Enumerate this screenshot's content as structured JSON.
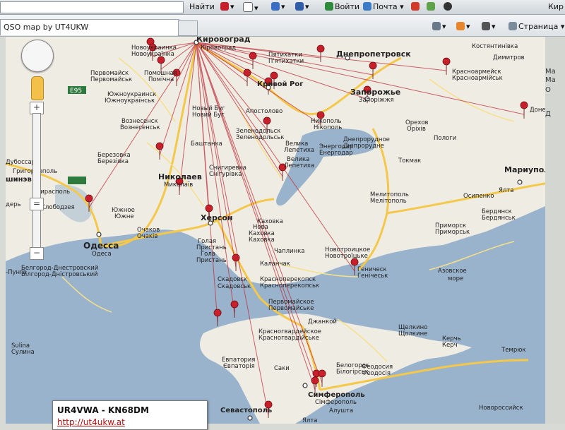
{
  "toolbar": {
    "find_label": "Найти",
    "login_label": "Войти",
    "mail_label": "Почта",
    "right_text": "Кир"
  },
  "tab": {
    "title": "QSO map by UT4UKW"
  },
  "commands": {
    "page_label": "Страница"
  },
  "map": {
    "labels": [
      {
        "id": "kirovograd",
        "text": "Кировоград",
        "bold": true
      },
      {
        "id": "kirovograd2",
        "text": "Кіровоград"
      },
      {
        "id": "novoukrainka",
        "text": "Новоукраинка"
      },
      {
        "id": "novoukrainka2",
        "text": "Новоукраїнка"
      },
      {
        "id": "pervomaysk",
        "text": "Первомайск"
      },
      {
        "id": "pervomaysk2",
        "text": "Первомайськ"
      },
      {
        "id": "pomoshnaya",
        "text": "Помошная"
      },
      {
        "id": "pomichna",
        "text": "Помічна"
      },
      {
        "id": "yuzhnoukrainsk",
        "text": "Южноукраинск"
      },
      {
        "id": "yuzhnoukrainsk2",
        "text": "Южноукраїнськ"
      },
      {
        "id": "voznesensk",
        "text": "Вознесенск"
      },
      {
        "id": "voznesensk2",
        "text": "Вознесенськ"
      },
      {
        "id": "novybug",
        "text": "Новый Буг"
      },
      {
        "id": "novybug2",
        "text": "Новий Буг"
      },
      {
        "id": "pyatikhatki",
        "text": "Пятихатки"
      },
      {
        "id": "piatykhatky",
        "text": "П'ятихатки"
      },
      {
        "id": "krivoy",
        "text": "Кривой Рог",
        "bold": true
      },
      {
        "id": "dnepro",
        "text": "Днепропетровск",
        "bold": true
      },
      {
        "id": "zaporozhye",
        "text": "Запорожье",
        "bold": true
      },
      {
        "id": "zaporizhia",
        "text": "Запоріжжя"
      },
      {
        "id": "apostolovo",
        "text": "Апостолово"
      },
      {
        "id": "nikopol",
        "text": "Никополь"
      },
      {
        "id": "nikopol2",
        "text": "Нікополь"
      },
      {
        "id": "zelenodolsk",
        "text": "Зеленодольск"
      },
      {
        "id": "zelenodolsk2",
        "text": "Зеленодольськ"
      },
      {
        "id": "krasnoarmeysk",
        "text": "Красноармейск"
      },
      {
        "id": "krasnoarmiysk",
        "text": "Красноармійськ"
      },
      {
        "id": "kostiantynivka",
        "text": "Костянтинівка"
      },
      {
        "id": "dimitrov",
        "text": "Димитров"
      },
      {
        "id": "donets",
        "text": "Донец"
      },
      {
        "id": "berezovka",
        "text": "Березовка"
      },
      {
        "id": "berezivka",
        "text": "Березівка"
      },
      {
        "id": "dubossary",
        "text": "Дубоссары"
      },
      {
        "id": "grigoriopol",
        "text": "Григориополь"
      },
      {
        "id": "chisinau",
        "text": "шинэв"
      },
      {
        "id": "tiraspol",
        "text": "Тирасполь"
      },
      {
        "id": "slobodzeya",
        "text": "Слободзея"
      },
      {
        "id": "bendery",
        "text": "дерь"
      },
      {
        "id": "bashtanka",
        "text": "Баштанка"
      },
      {
        "id": "snigirevka",
        "text": "Снигиревка"
      },
      {
        "id": "snihurivka",
        "text": "Снігурівка"
      },
      {
        "id": "nikolaev",
        "text": "Николаев",
        "bold": true
      },
      {
        "id": "mykolaiv",
        "text": "Миколаїв"
      },
      {
        "id": "yuzhnoe",
        "text": "Южное"
      },
      {
        "id": "yuzhne",
        "text": "Южне"
      },
      {
        "id": "ochakov",
        "text": "Очаков"
      },
      {
        "id": "ochakiv",
        "text": "Очаків"
      },
      {
        "id": "odessa",
        "text": "Одесса",
        "bold": true
      },
      {
        "id": "odesa",
        "text": "Одеса"
      },
      {
        "id": "kherson",
        "text": "Херсон",
        "bold": true
      },
      {
        "id": "golaya",
        "text": "Голая"
      },
      {
        "id": "pristan",
        "text": "Пристань"
      },
      {
        "id": "hola",
        "text": "Гола"
      },
      {
        "id": "prystan",
        "text": "Пристань"
      },
      {
        "id": "kakhovka",
        "text": "Каховка"
      },
      {
        "id": "nova",
        "text": "Нова"
      },
      {
        "id": "kakhovka2",
        "text": "Каховка"
      },
      {
        "id": "kakhovka3",
        "text": "Каховка"
      },
      {
        "id": "velikaya",
        "text": "Велика"
      },
      {
        "id": "lepetikha",
        "text": "Лепетиха"
      },
      {
        "id": "velyka",
        "text": "Велика"
      },
      {
        "id": "lepetykha",
        "text": "Лепетиха"
      },
      {
        "id": "energodar",
        "text": "Энергодар"
      },
      {
        "id": "enerhodar",
        "text": "Енергодар"
      },
      {
        "id": "dneprorudnoe",
        "text": "Днепрорудное"
      },
      {
        "id": "dniprorudne",
        "text": "Дніпрорудне"
      },
      {
        "id": "orekhov",
        "text": "Орехов"
      },
      {
        "id": "orikhiv",
        "text": "Оріхів"
      },
      {
        "id": "pology",
        "text": "Пологи"
      },
      {
        "id": "tokmak",
        "text": "Токмак"
      },
      {
        "id": "melitopol",
        "text": "Мелитополь"
      },
      {
        "id": "melitopol2",
        "text": "Мелітополь"
      },
      {
        "id": "mariupol",
        "text": "Мариуполь",
        "bold": true
      },
      {
        "id": "yalta",
        "text": "Ялта"
      },
      {
        "id": "osipenko",
        "text": "Осипенко"
      },
      {
        "id": "berdyansk",
        "text": "Бердянск"
      },
      {
        "id": "berdiansk",
        "text": "Бердянськ"
      },
      {
        "id": "primorsk",
        "text": "Приморск"
      },
      {
        "id": "prymorsk",
        "text": "Приморськ"
      },
      {
        "id": "chaplinka",
        "text": "Чаплинка"
      },
      {
        "id": "novotroitskoe",
        "text": "Новотроицкое"
      },
      {
        "id": "novotroitske",
        "text": "Новотроїцьке"
      },
      {
        "id": "kalanchak",
        "text": "Каланчак"
      },
      {
        "id": "skadovsk",
        "text": "Скадовск"
      },
      {
        "id": "skadovsk2",
        "text": "Скадовськ"
      },
      {
        "id": "krasnoperekopsk",
        "text": "Красноперекопск"
      },
      {
        "id": "krasnoperekopsk2",
        "text": "Красноперекопськ"
      },
      {
        "id": "genichesk",
        "text": "Геническ"
      },
      {
        "id": "henichesk",
        "text": "Генічеськ"
      },
      {
        "id": "azov_sea",
        "text": "Азовское"
      },
      {
        "id": "azov_sea2",
        "text": "море"
      },
      {
        "id": "pervomayskoe",
        "text": "Первомайское"
      },
      {
        "id": "pervomaiske",
        "text": "Первомайське"
      },
      {
        "id": "dzhankoy",
        "text": "Джанкой"
      },
      {
        "id": "krasnogvardeyskoe",
        "text": "Красногвардейское"
      },
      {
        "id": "krasnohvardiiske",
        "text": "Красногвардійське"
      },
      {
        "id": "shchelkino",
        "text": "Щелкино"
      },
      {
        "id": "shcholkine",
        "text": "Щолкине"
      },
      {
        "id": "kerch",
        "text": "Керчь"
      },
      {
        "id": "kerch2",
        "text": "Керч"
      },
      {
        "id": "temryuk",
        "text": "Темрюк"
      },
      {
        "id": "sulina",
        "text": "Sulina"
      },
      {
        "id": "sulina2",
        "text": "Сулина"
      },
      {
        "id": "belgorod",
        "text": "Белгород-Днестровский"
      },
      {
        "id": "bilhorod",
        "text": "Білгород-Дністровський"
      },
      {
        "id": "lunga",
        "text": "-Пунга"
      },
      {
        "id": "evpatoria",
        "text": "Евпатория"
      },
      {
        "id": "yevpatoriia",
        "text": "Євпаторія"
      },
      {
        "id": "saki",
        "text": "Саки"
      },
      {
        "id": "belogorsk",
        "text": "Белогорск"
      },
      {
        "id": "bilohirsk",
        "text": "Білогірськ"
      },
      {
        "id": "feodosia",
        "text": "Феодосия"
      },
      {
        "id": "feodosiia",
        "text": "Феодосія"
      },
      {
        "id": "simferopol",
        "text": "Симферополь",
        "bold": true
      },
      {
        "id": "simferopol2",
        "text": "Сімферополь"
      },
      {
        "id": "alushta",
        "text": "Алушта"
      },
      {
        "id": "sevastopol",
        "text": "Севастополь",
        "bold": true
      },
      {
        "id": "yalta2",
        "text": "Ялта"
      },
      {
        "id": "novorossiysk",
        "text": "Новороссийск"
      },
      {
        "id": "e95_a",
        "text": "E95"
      },
      {
        "id": "e95_b",
        "text": "E95"
      }
    ],
    "popup": {
      "title": "UR4VWA - KN68DM",
      "link": "http://ut4ukw.at"
    }
  },
  "right_edge": {
    "lines": [
      "Ма",
      "Ма",
      "О",
      "Д"
    ]
  },
  "colors": {
    "road": "#f4c84a",
    "sea": "#99b3cc",
    "land": "#efece4",
    "qso_line": "#c0303a",
    "marker": "#c8202b"
  }
}
